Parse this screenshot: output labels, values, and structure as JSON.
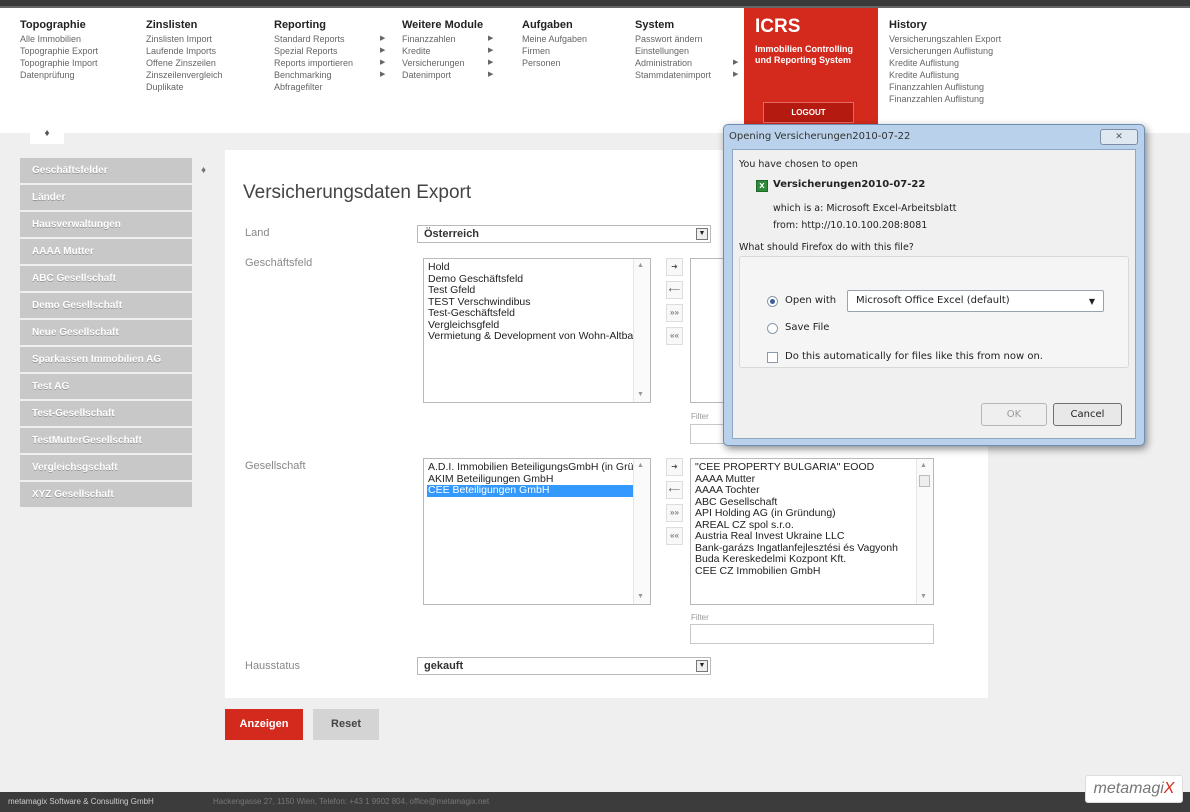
{
  "nav": {
    "columns": [
      {
        "title": "Topographie",
        "items": [
          "Alle Immobilien",
          "Topographie Export",
          "Topographie Import",
          "Datenprüfung"
        ]
      },
      {
        "title": "Zinslisten",
        "items": [
          "Zinslisten Import",
          "Laufende Imports",
          "Offene Zinszeilen",
          "Zinszeilenvergleich",
          "Duplikate"
        ]
      },
      {
        "title": "Reporting",
        "items": [
          "Standard Reports",
          "Spezial Reports",
          "Reports importieren",
          "Benchmarking",
          "Abfragefilter"
        ]
      },
      {
        "title": "Weitere Module",
        "items": [
          "Finanzzahlen",
          "Kredite",
          "Versicherungen",
          "Datenimport"
        ]
      },
      {
        "title": "Aufgaben",
        "items": [
          "Meine Aufgaben",
          "Firmen",
          "Personen"
        ]
      },
      {
        "title": "System",
        "items": [
          "Passwort ändern",
          "Einstellungen",
          "Administration",
          "Stammdatenimport"
        ]
      },
      {
        "title": "History",
        "items": [
          "Versicherungszahlen Export",
          "Versicherungen Auflistung",
          "Kredite Auflistung",
          "Kredite Auflistung",
          "Finanzzahlen Auflistung",
          "Finanzzahlen Auflistung"
        ]
      }
    ],
    "brand": {
      "logo": "ICRS",
      "line1": "Immobilien Controlling",
      "line2": "und Reporting System",
      "logout": "LOGOUT"
    }
  },
  "sidebar": {
    "items": [
      "Geschäftsfelder",
      "Länder",
      "Hausverwaltungen",
      "AAAA Mutter",
      "ABC Gesellschaft",
      "Demo Gesellschaft",
      "Neue Gesellschaft",
      "Sparkassen Immobilien AG",
      "Test AG",
      "Test-Gesellschaft",
      "TestMutterGesellschaft",
      "Vergleichsgschaft",
      "XYZ Gesellschaft"
    ]
  },
  "main": {
    "title": "Versicherungsdaten Export",
    "land_label": "Land",
    "land_value": "Österreich",
    "gf_label": "Geschäftsfeld",
    "gf_items": [
      "Hold",
      "Demo Geschäftsfeld",
      "Test Gfeld",
      "TEST Verschwindibus",
      "Test-Geschäftsfeld",
      "Vergleichsgfeld",
      "Vermietung & Development von Wohn-Altba"
    ],
    "filter_label": "Filter",
    "ges_label": "Gesellschaft",
    "ges_items": [
      "A.D.I. Immobilien BeteiligungsGmbH (in Grü",
      "AKIM Beteiligungen GmbH",
      "CEE Beteiligungen GmbH"
    ],
    "ges_selected": "CEE Beteiligungen GmbH",
    "ges_available": [
      "\"CEE PROPERTY BULGARIA\" EOOD",
      "AAAA Mutter",
      "AAAA Tochter",
      "ABC Gesellschaft",
      "API Holding AG (in Gründung)",
      "AREAL CZ spol s.r.o.",
      "Austria Real Invest Ukraine LLC",
      "Bank-garázs Ingatlanfejlesztési és Vagyonh",
      "Buda Kereskedelmi Kozpont Kft.",
      "CEE CZ Immobilien GmbH"
    ],
    "haus_label": "Hausstatus",
    "haus_value": "gekauft",
    "btn_show": "Anzeigen",
    "btn_reset": "Reset"
  },
  "footer": {
    "company": "metamagix Software & Consulting GmbH",
    "address": "Hackengasse 27, 1150 Wien, Telefon: +43 1 9902 804, office@metamagix.net",
    "logo": "metamagi",
    "logo_x": "X"
  },
  "dialog": {
    "title": "Opening Versicherungen2010-07-22",
    "chosen": "You have chosen to open",
    "filename": "Versicherungen2010-07-22",
    "which": "which is a:  Microsoft Excel-Arbeitsblatt",
    "from": "from:  http://10.10.100.208:8081",
    "question": "What should Firefox do with this file?",
    "open_with": "Open with",
    "app": "Microsoft Office Excel (default)",
    "save": "Save File",
    "auto": "Do this automatically for files like this from now on.",
    "ok": "OK",
    "cancel": "Cancel",
    "close_icon": "close-icon"
  }
}
